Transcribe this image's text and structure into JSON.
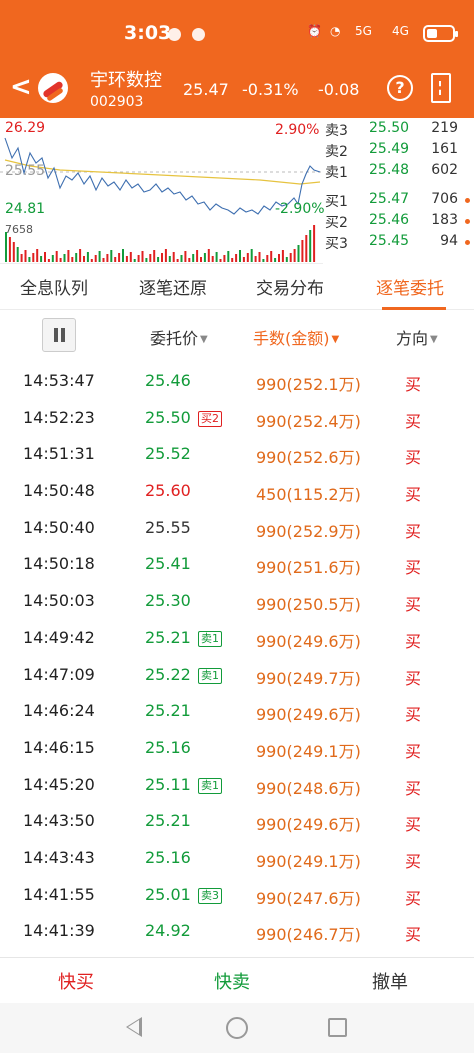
{
  "status_bar": {
    "time": "3:03",
    "network": "5G",
    "network2": "4G"
  },
  "stock": {
    "name": "宇环数控",
    "code": "002903",
    "price": "25.47",
    "change_pct": "-0.31%",
    "change": "-0.08"
  },
  "chart": {
    "high": "26.29",
    "prev_close": "25.55",
    "low": "24.81",
    "high_pct": "2.90%",
    "low_pct": "-2.90%",
    "volume_max": "7658"
  },
  "order_book": [
    {
      "label": "卖3",
      "price": "25.50",
      "volume": "219",
      "dot": ""
    },
    {
      "label": "卖2",
      "price": "25.49",
      "volume": "161",
      "dot": ""
    },
    {
      "label": "卖1",
      "price": "25.48",
      "volume": "602",
      "dot": ""
    },
    {
      "label": "买1",
      "price": "25.47",
      "volume": "706",
      "dot": "#f0671f"
    },
    {
      "label": "买2",
      "price": "25.46",
      "volume": "183",
      "dot": "#f0671f"
    },
    {
      "label": "买3",
      "price": "25.45",
      "volume": "94",
      "dot": "#f0671f"
    }
  ],
  "tabs": [
    {
      "label": "全息队列",
      "active": false
    },
    {
      "label": "逐笔还原",
      "active": false
    },
    {
      "label": "交易分布",
      "active": false
    },
    {
      "label": "逐笔委托",
      "active": true
    }
  ],
  "columns": {
    "price": "委托价",
    "amount": "手数(金额)",
    "direction": "方向"
  },
  "trades": [
    {
      "time": "14:53:47",
      "price": "25.46",
      "price_color": "#129b3a",
      "badge": "",
      "badge_color": "",
      "amount": "990(252.1万)",
      "dir": "买"
    },
    {
      "time": "14:52:23",
      "price": "25.50",
      "price_color": "#129b3a",
      "badge": "买2",
      "badge_color": "#e02020",
      "amount": "990(252.4万)",
      "dir": "买"
    },
    {
      "time": "14:51:31",
      "price": "25.52",
      "price_color": "#129b3a",
      "badge": "",
      "badge_color": "",
      "amount": "990(252.6万)",
      "dir": "买"
    },
    {
      "time": "14:50:48",
      "price": "25.60",
      "price_color": "#e02020",
      "badge": "",
      "badge_color": "",
      "amount": "450(115.2万)",
      "dir": "买"
    },
    {
      "time": "14:50:40",
      "price": "25.55",
      "price_color": "#333333",
      "badge": "",
      "badge_color": "",
      "amount": "990(252.9万)",
      "dir": "买"
    },
    {
      "time": "14:50:18",
      "price": "25.41",
      "price_color": "#129b3a",
      "badge": "",
      "badge_color": "",
      "amount": "990(251.6万)",
      "dir": "买"
    },
    {
      "time": "14:50:03",
      "price": "25.30",
      "price_color": "#129b3a",
      "badge": "",
      "badge_color": "",
      "amount": "990(250.5万)",
      "dir": "买"
    },
    {
      "time": "14:49:42",
      "price": "25.21",
      "price_color": "#129b3a",
      "badge": "卖1",
      "badge_color": "#129b3a",
      "amount": "990(249.6万)",
      "dir": "买"
    },
    {
      "time": "14:47:09",
      "price": "25.22",
      "price_color": "#129b3a",
      "badge": "卖1",
      "badge_color": "#129b3a",
      "amount": "990(249.7万)",
      "dir": "买"
    },
    {
      "time": "14:46:24",
      "price": "25.21",
      "price_color": "#129b3a",
      "badge": "",
      "badge_color": "",
      "amount": "990(249.6万)",
      "dir": "买"
    },
    {
      "time": "14:46:15",
      "price": "25.16",
      "price_color": "#129b3a",
      "badge": "",
      "badge_color": "",
      "amount": "990(249.1万)",
      "dir": "买"
    },
    {
      "time": "14:45:20",
      "price": "25.11",
      "price_color": "#129b3a",
      "badge": "卖1",
      "badge_color": "#129b3a",
      "amount": "990(248.6万)",
      "dir": "买"
    },
    {
      "time": "14:43:50",
      "price": "25.21",
      "price_color": "#129b3a",
      "badge": "",
      "badge_color": "",
      "amount": "990(249.6万)",
      "dir": "买"
    },
    {
      "time": "14:43:43",
      "price": "25.16",
      "price_color": "#129b3a",
      "badge": "",
      "badge_color": "",
      "amount": "990(249.1万)",
      "dir": "买"
    },
    {
      "time": "14:41:55",
      "price": "25.01",
      "price_color": "#129b3a",
      "badge": "卖3",
      "badge_color": "#129b3a",
      "amount": "990(247.6万)",
      "dir": "买"
    },
    {
      "time": "14:41:39",
      "price": "24.92",
      "price_color": "#129b3a",
      "badge": "",
      "badge_color": "",
      "amount": "990(246.7万)",
      "dir": "买"
    }
  ],
  "actions": {
    "buy": "快买",
    "sell": "快卖",
    "cancel": "撤单"
  },
  "colors": {
    "brand": "#f0671f",
    "up": "#e02020",
    "down": "#129b3a",
    "amount": "#e06a1b"
  }
}
